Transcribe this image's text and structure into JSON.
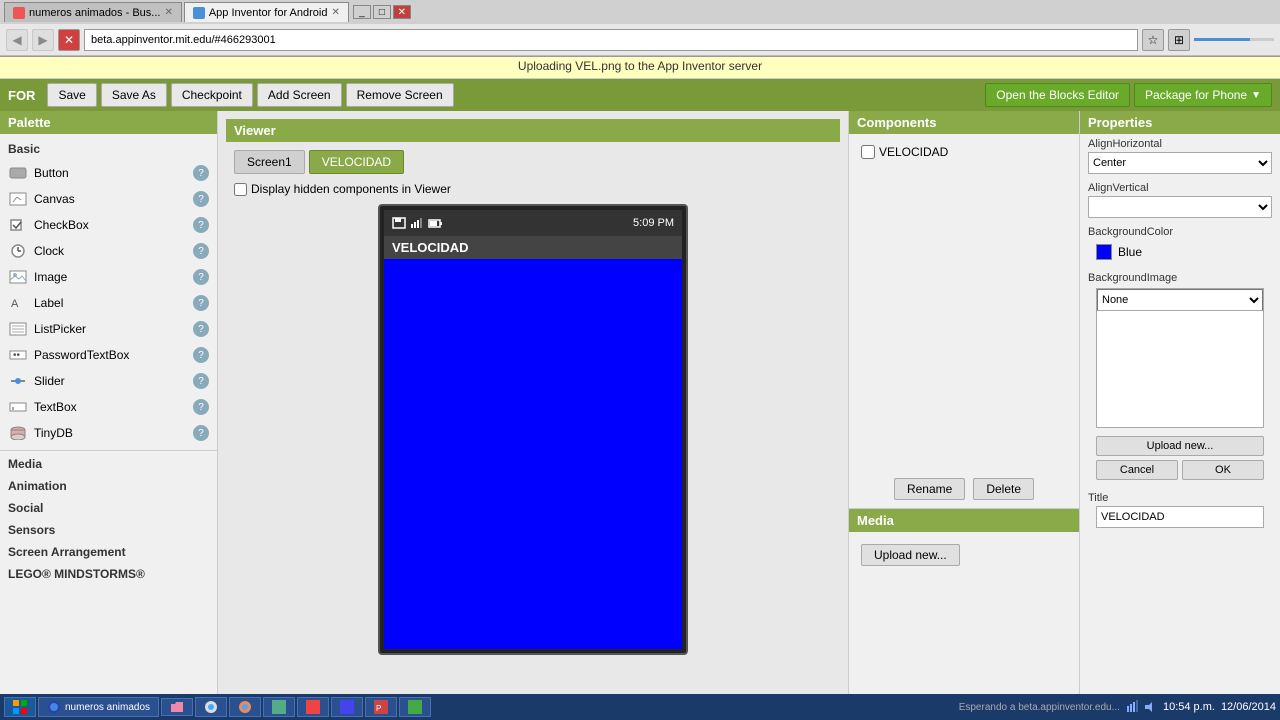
{
  "browser": {
    "tabs": [
      {
        "label": "numeros animados - Bus...",
        "active": false,
        "favicon_color": "#e55"
      },
      {
        "label": "App Inventor for Android",
        "active": true,
        "favicon_color": "#4a90d9"
      }
    ],
    "address": "beta.appinventor.mit.edu/#466293001",
    "window_controls": [
      "_",
      "□",
      "×"
    ]
  },
  "status_bar": {
    "message": "Uploading VEL.png to the App Inventor server"
  },
  "app_toolbar": {
    "for_label": "FOR",
    "save_btn": "Save",
    "save_as_btn": "Save As",
    "checkpoint_btn": "Checkpoint",
    "add_screen_btn": "Add Screen",
    "remove_screen_btn": "Remove Screen",
    "blocks_editor_btn": "Open the Blocks Editor",
    "package_btn": "Package for Phone"
  },
  "palette": {
    "header": "Palette",
    "sections": [
      {
        "title": "Basic",
        "items": [
          {
            "name": "Button",
            "icon": "btn"
          },
          {
            "name": "Canvas",
            "icon": "canvas"
          },
          {
            "name": "CheckBox",
            "icon": "check"
          },
          {
            "name": "Clock",
            "icon": "clock"
          },
          {
            "name": "Image",
            "icon": "image"
          },
          {
            "name": "Label",
            "icon": "label"
          },
          {
            "name": "ListPicker",
            "icon": "list"
          },
          {
            "name": "PasswordTextBox",
            "icon": "pwd"
          },
          {
            "name": "Slider",
            "icon": "slider"
          },
          {
            "name": "TextBox",
            "icon": "text"
          },
          {
            "name": "TinyDB",
            "icon": "db"
          }
        ]
      },
      {
        "title": "Media",
        "items": []
      },
      {
        "title": "Animation",
        "items": []
      },
      {
        "title": "Social",
        "items": []
      },
      {
        "title": "Sensors",
        "items": []
      },
      {
        "title": "Screen Arrangement",
        "items": []
      },
      {
        "title": "LEGO® MINDSTORMS®",
        "items": []
      }
    ]
  },
  "viewer": {
    "header": "Viewer",
    "tabs": [
      "Screen1",
      "VELOCIDAD"
    ],
    "active_tab": "VELOCIDAD",
    "checkbox_label": "Display hidden components in Viewer",
    "phone": {
      "time": "5:09 PM",
      "screen_title": "VELOCIDAD"
    }
  },
  "components": {
    "header": "Components",
    "tree": [
      {
        "name": "VELOCIDAD",
        "checked": false
      }
    ],
    "rename_btn": "Rename",
    "delete_btn": "Delete",
    "media_header": "Media",
    "media_upload_btn": "Upload new..."
  },
  "properties": {
    "header": "Properties",
    "align_horizontal_label": "AlignHorizontal",
    "align_horizontal_value": "Center",
    "align_vertical_label": "AlignVertical",
    "align_vertical_value": "",
    "bg_color_label": "BackgroundColor",
    "bg_color_name": "Blue",
    "bg_color_hex": "#0000ff",
    "bg_image_label": "BackgroundImage",
    "bg_image_value": "None",
    "upload_new_btn": "Upload new...",
    "cancel_btn": "Cancel",
    "ok_btn": "OK",
    "title_label": "Title",
    "title_value": "VELOCIDAD"
  },
  "taskbar": {
    "items": [
      {
        "label": "numeros animados - Bu...",
        "icon": "ie"
      },
      {
        "label": "",
        "icon": "folder"
      },
      {
        "label": "",
        "icon": "chrome"
      },
      {
        "label": "",
        "icon": "firefox"
      },
      {
        "label": "",
        "icon": "winamp"
      },
      {
        "label": "",
        "icon": "app1"
      },
      {
        "label": "",
        "icon": "app2"
      },
      {
        "label": "",
        "icon": "app3"
      },
      {
        "label": "",
        "icon": "ppt"
      },
      {
        "label": "",
        "icon": "app4"
      }
    ],
    "status_text": "Esperando a beta.appinventor.edu...",
    "time": "10:54 p.m.",
    "date": "12/06/2014"
  }
}
